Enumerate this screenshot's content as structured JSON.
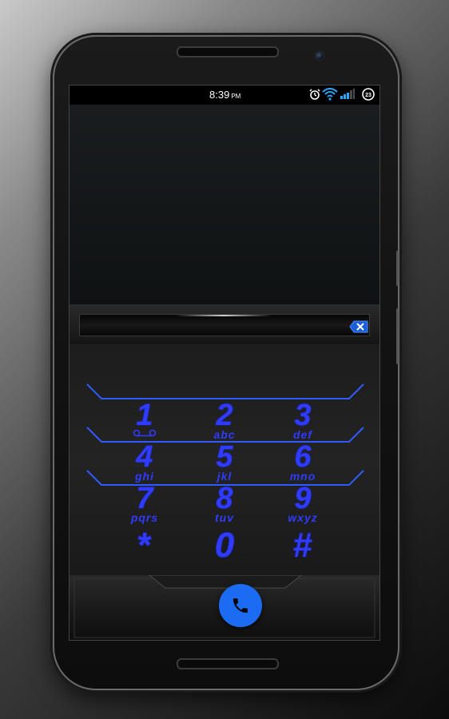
{
  "status_bar": {
    "time": "8:39",
    "ampm": "PM",
    "notification_badge": "23",
    "icons": [
      "alarm-icon",
      "wifi-icon",
      "signal-icon",
      "notification-count-icon"
    ]
  },
  "dialer": {
    "number_value": "",
    "keys": [
      {
        "digit": "1",
        "letters": ""
      },
      {
        "digit": "2",
        "letters": "abc"
      },
      {
        "digit": "3",
        "letters": "def"
      },
      {
        "digit": "4",
        "letters": "ghi"
      },
      {
        "digit": "5",
        "letters": "jkl"
      },
      {
        "digit": "6",
        "letters": "mno"
      },
      {
        "digit": "7",
        "letters": "pqrs"
      },
      {
        "digit": "8",
        "letters": "tuv"
      },
      {
        "digit": "9",
        "letters": "wxyz"
      },
      {
        "digit": "*",
        "letters": ""
      },
      {
        "digit": "0",
        "letters": ""
      },
      {
        "digit": "#",
        "letters": ""
      }
    ]
  },
  "nav": {
    "buttons": [
      "recents-icon",
      "home-icon",
      "back-icon"
    ]
  },
  "colors": {
    "accent": "#2f3bff",
    "call_button": "#1b6cf2",
    "nav_icon": "#2a5bff"
  }
}
